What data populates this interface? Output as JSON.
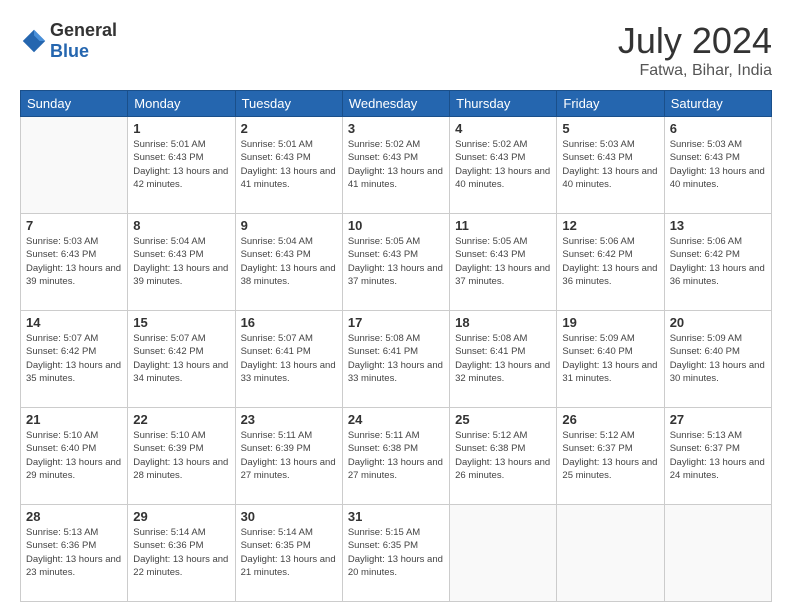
{
  "logo": {
    "general": "General",
    "blue": "Blue"
  },
  "title": {
    "month_year": "July 2024",
    "location": "Fatwa, Bihar, India"
  },
  "days_of_week": [
    "Sunday",
    "Monday",
    "Tuesday",
    "Wednesday",
    "Thursday",
    "Friday",
    "Saturday"
  ],
  "weeks": [
    [
      {
        "day": "",
        "info": ""
      },
      {
        "day": "1",
        "info": "Sunrise: 5:01 AM\nSunset: 6:43 PM\nDaylight: 13 hours\nand 42 minutes."
      },
      {
        "day": "2",
        "info": "Sunrise: 5:01 AM\nSunset: 6:43 PM\nDaylight: 13 hours\nand 41 minutes."
      },
      {
        "day": "3",
        "info": "Sunrise: 5:02 AM\nSunset: 6:43 PM\nDaylight: 13 hours\nand 41 minutes."
      },
      {
        "day": "4",
        "info": "Sunrise: 5:02 AM\nSunset: 6:43 PM\nDaylight: 13 hours\nand 40 minutes."
      },
      {
        "day": "5",
        "info": "Sunrise: 5:03 AM\nSunset: 6:43 PM\nDaylight: 13 hours\nand 40 minutes."
      },
      {
        "day": "6",
        "info": "Sunrise: 5:03 AM\nSunset: 6:43 PM\nDaylight: 13 hours\nand 40 minutes."
      }
    ],
    [
      {
        "day": "7",
        "info": "Sunrise: 5:03 AM\nSunset: 6:43 PM\nDaylight: 13 hours\nand 39 minutes."
      },
      {
        "day": "8",
        "info": "Sunrise: 5:04 AM\nSunset: 6:43 PM\nDaylight: 13 hours\nand 39 minutes."
      },
      {
        "day": "9",
        "info": "Sunrise: 5:04 AM\nSunset: 6:43 PM\nDaylight: 13 hours\nand 38 minutes."
      },
      {
        "day": "10",
        "info": "Sunrise: 5:05 AM\nSunset: 6:43 PM\nDaylight: 13 hours\nand 37 minutes."
      },
      {
        "day": "11",
        "info": "Sunrise: 5:05 AM\nSunset: 6:43 PM\nDaylight: 13 hours\nand 37 minutes."
      },
      {
        "day": "12",
        "info": "Sunrise: 5:06 AM\nSunset: 6:42 PM\nDaylight: 13 hours\nand 36 minutes."
      },
      {
        "day": "13",
        "info": "Sunrise: 5:06 AM\nSunset: 6:42 PM\nDaylight: 13 hours\nand 36 minutes."
      }
    ],
    [
      {
        "day": "14",
        "info": "Sunrise: 5:07 AM\nSunset: 6:42 PM\nDaylight: 13 hours\nand 35 minutes."
      },
      {
        "day": "15",
        "info": "Sunrise: 5:07 AM\nSunset: 6:42 PM\nDaylight: 13 hours\nand 34 minutes."
      },
      {
        "day": "16",
        "info": "Sunrise: 5:07 AM\nSunset: 6:41 PM\nDaylight: 13 hours\nand 33 minutes."
      },
      {
        "day": "17",
        "info": "Sunrise: 5:08 AM\nSunset: 6:41 PM\nDaylight: 13 hours\nand 33 minutes."
      },
      {
        "day": "18",
        "info": "Sunrise: 5:08 AM\nSunset: 6:41 PM\nDaylight: 13 hours\nand 32 minutes."
      },
      {
        "day": "19",
        "info": "Sunrise: 5:09 AM\nSunset: 6:40 PM\nDaylight: 13 hours\nand 31 minutes."
      },
      {
        "day": "20",
        "info": "Sunrise: 5:09 AM\nSunset: 6:40 PM\nDaylight: 13 hours\nand 30 minutes."
      }
    ],
    [
      {
        "day": "21",
        "info": "Sunrise: 5:10 AM\nSunset: 6:40 PM\nDaylight: 13 hours\nand 29 minutes."
      },
      {
        "day": "22",
        "info": "Sunrise: 5:10 AM\nSunset: 6:39 PM\nDaylight: 13 hours\nand 28 minutes."
      },
      {
        "day": "23",
        "info": "Sunrise: 5:11 AM\nSunset: 6:39 PM\nDaylight: 13 hours\nand 27 minutes."
      },
      {
        "day": "24",
        "info": "Sunrise: 5:11 AM\nSunset: 6:38 PM\nDaylight: 13 hours\nand 27 minutes."
      },
      {
        "day": "25",
        "info": "Sunrise: 5:12 AM\nSunset: 6:38 PM\nDaylight: 13 hours\nand 26 minutes."
      },
      {
        "day": "26",
        "info": "Sunrise: 5:12 AM\nSunset: 6:37 PM\nDaylight: 13 hours\nand 25 minutes."
      },
      {
        "day": "27",
        "info": "Sunrise: 5:13 AM\nSunset: 6:37 PM\nDaylight: 13 hours\nand 24 minutes."
      }
    ],
    [
      {
        "day": "28",
        "info": "Sunrise: 5:13 AM\nSunset: 6:36 PM\nDaylight: 13 hours\nand 23 minutes."
      },
      {
        "day": "29",
        "info": "Sunrise: 5:14 AM\nSunset: 6:36 PM\nDaylight: 13 hours\nand 22 minutes."
      },
      {
        "day": "30",
        "info": "Sunrise: 5:14 AM\nSunset: 6:35 PM\nDaylight: 13 hours\nand 21 minutes."
      },
      {
        "day": "31",
        "info": "Sunrise: 5:15 AM\nSunset: 6:35 PM\nDaylight: 13 hours\nand 20 minutes."
      },
      {
        "day": "",
        "info": ""
      },
      {
        "day": "",
        "info": ""
      },
      {
        "day": "",
        "info": ""
      }
    ]
  ]
}
